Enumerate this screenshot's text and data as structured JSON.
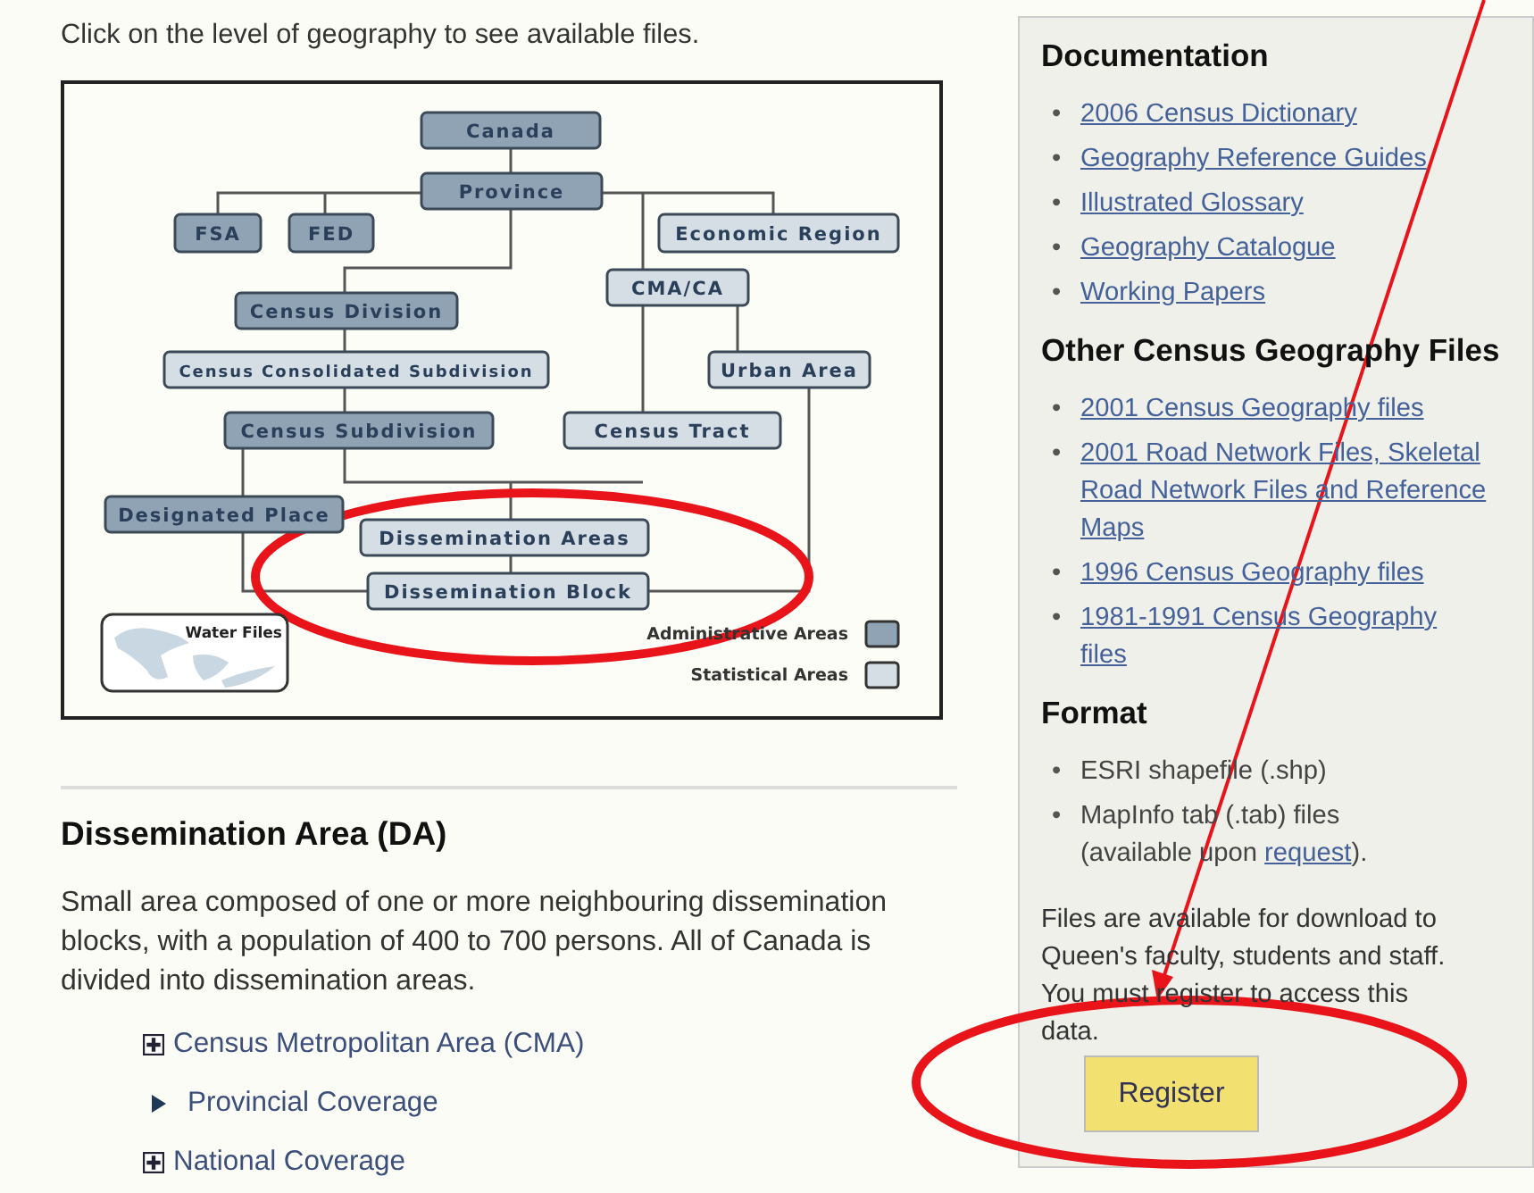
{
  "intro": "Click on the level of geography to see available files.",
  "diagram": {
    "nodes": [
      {
        "label": "Canada",
        "kind": "administrative"
      },
      {
        "label": "Province",
        "kind": "administrative"
      },
      {
        "label": "FSA",
        "kind": "administrative"
      },
      {
        "label": "FED",
        "kind": "administrative"
      },
      {
        "label": "Economic Region",
        "kind": "statistical"
      },
      {
        "label": "CMA/CA",
        "kind": "statistical"
      },
      {
        "label": "Census Division",
        "kind": "administrative"
      },
      {
        "label": "Census Consolidated Subdivision",
        "kind": "statistical"
      },
      {
        "label": "Urban Area",
        "kind": "statistical"
      },
      {
        "label": "Census Subdivision",
        "kind": "administrative"
      },
      {
        "label": "Census Tract",
        "kind": "statistical"
      },
      {
        "label": "Designated Place",
        "kind": "administrative"
      },
      {
        "label": "Dissemination Areas",
        "kind": "statistical"
      },
      {
        "label": "Dissemination Block",
        "kind": "statistical"
      }
    ],
    "water_files": "Water Files",
    "legend": [
      {
        "label": "Administrative Areas",
        "kind": "administrative"
      },
      {
        "label": "Statistical Areas",
        "kind": "statistical"
      }
    ]
  },
  "section": {
    "title": "Dissemination Area (DA)",
    "text": "Small area composed of one or more neighbouring dissemination blocks, with a population of 400 to 700 persons. All of Canada is divided into dissemination areas.",
    "items": [
      {
        "label": "Census Metropolitan Area (CMA)",
        "kind": "plus"
      },
      {
        "label": "Provincial Coverage",
        "kind": "arrow"
      },
      {
        "label": "National Coverage",
        "kind": "plus"
      }
    ]
  },
  "sidebar": {
    "groups": [
      {
        "title": "Documentation",
        "links": [
          {
            "bullet": "•",
            "label": "2006 Census Dictionary"
          },
          {
            "bullet": "•",
            "label": "Geography Reference Guides"
          },
          {
            "bullet": "•",
            "label": "Illustrated Glossary"
          },
          {
            "bullet": "•",
            "label": "Geography Catalogue"
          },
          {
            "bullet": "•",
            "label": "Working Papers"
          }
        ]
      },
      {
        "title": "Other Census Geography Files",
        "links": [
          {
            "bullet": "•",
            "label": "2001 Census Geography files"
          },
          {
            "bullet": "•",
            "label": "2001 Road Network Files, Skeletal Road Network Files and Reference Maps"
          },
          {
            "bullet": "•",
            "label": "1996 Census Geography files"
          },
          {
            "bullet": "•",
            "label": "1981-1991 Census Geography files"
          }
        ]
      }
    ],
    "format": {
      "title": "Format",
      "items": [
        {
          "bullet": "•",
          "text": "ESRI shapefile (.shp)"
        },
        {
          "bullet": "•",
          "text": "MapInfo tab (.tab) files (available upon ",
          "link": "request",
          "after": ")."
        }
      ]
    },
    "note": "Files are available for download to Queen's faculty, students and staff. You must register to access this data.",
    "button": "Register"
  }
}
